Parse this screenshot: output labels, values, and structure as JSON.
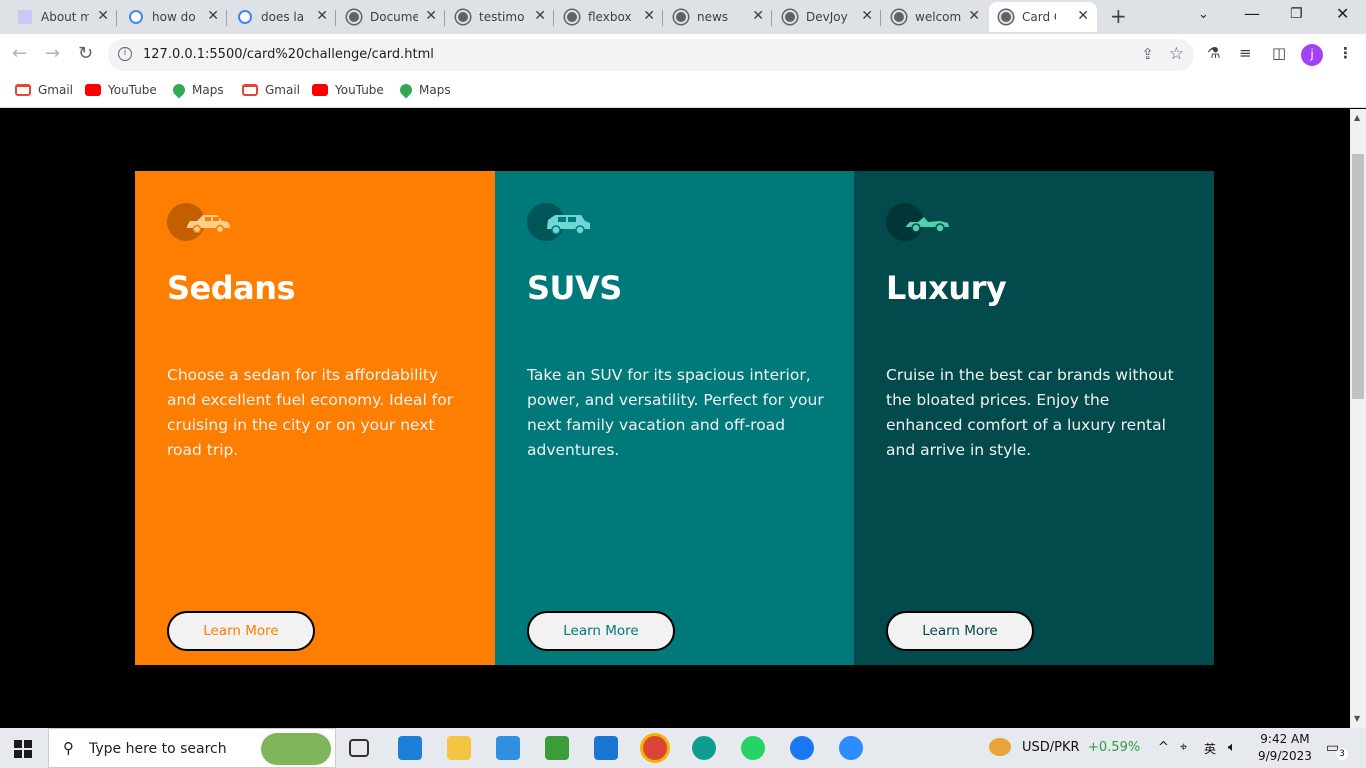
{
  "browser": {
    "tabs": [
      {
        "label": "About m",
        "favicon": "doc"
      },
      {
        "label": "how do",
        "favicon": "google"
      },
      {
        "label": "does la",
        "favicon": "google"
      },
      {
        "label": "Docume",
        "favicon": "globe"
      },
      {
        "label": "testimo",
        "favicon": "globe"
      },
      {
        "label": "flexbox",
        "favicon": "globe"
      },
      {
        "label": "news",
        "favicon": "globe"
      },
      {
        "label": "DevJoy",
        "favicon": "globe"
      },
      {
        "label": "welcom",
        "favicon": "globe"
      },
      {
        "label": "Card Ch",
        "favicon": "globe"
      }
    ],
    "url": "127.0.0.1:5500/card%20challenge/card.html",
    "profile_initial": "j",
    "bookmarks": [
      {
        "label": "Gmail",
        "icon": "gmail"
      },
      {
        "label": "YouTube",
        "icon": "yt"
      },
      {
        "label": "Maps",
        "icon": "maps"
      },
      {
        "label": "Gmail",
        "icon": "gmail"
      },
      {
        "label": "YouTube",
        "icon": "yt"
      },
      {
        "label": "Maps",
        "icon": "maps"
      }
    ]
  },
  "cards": [
    {
      "title": "Sedans",
      "text": "Choose a sedan for its affordability and excellent fuel economy. Ideal for cruising in the city or on your next road trip.",
      "button": "Learn More",
      "color": "#fd7e01"
    },
    {
      "title": "SUVS",
      "text": "Take an SUV for its spacious interior, power, and versatility. Perfect for your next family vacation and off-road adventures.",
      "button": "Learn More",
      "color": "#00797a"
    },
    {
      "title": "Luxury",
      "text": "Cruise in the best car brands without the bloated prices. Enjoy the enhanced comfort of a luxury rental and arrive in style.",
      "button": "Learn More",
      "color": "#024a4b"
    }
  ],
  "taskbar": {
    "search_placeholder": "Type here to search",
    "currency_label": "USD/PKR",
    "currency_change": "+0.59%",
    "ime": "英",
    "time": "9:42 AM",
    "date": "9/9/2023",
    "notification_count": "3"
  }
}
